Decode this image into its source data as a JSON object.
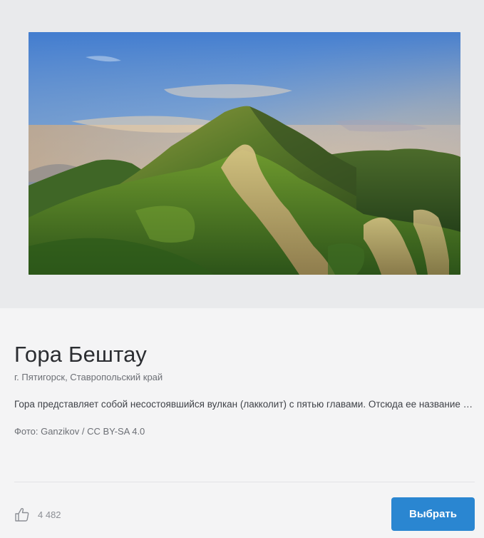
{
  "place": {
    "title": "Гора Бештау",
    "location": "г. Пятигорск, Ставропольский край",
    "description": "Гора представляет собой несостоявшийся вулкан (лакколит) с пятью главами. Отсюда ее название — «пять гор».",
    "credit": "Фото: Ganzikov / CC BY-SA 4.0",
    "photo_icon": "mountain-photo"
  },
  "footer": {
    "like_icon": "thumbs-up-icon",
    "like_count": "4 482",
    "choose_label": "Выбрать"
  },
  "colors": {
    "accent": "#2a86d1",
    "background": "#f4f4f5",
    "image_backdrop": "#e9eaec"
  }
}
